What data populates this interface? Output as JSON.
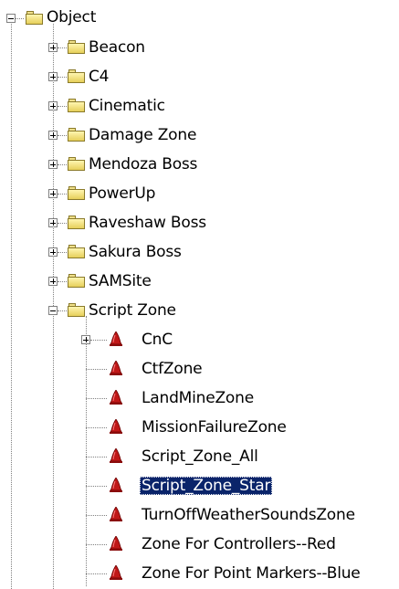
{
  "tree": {
    "root": {
      "label": "Object",
      "icon": "folder-icon",
      "expanded": true
    },
    "folders": [
      {
        "label": "Beacon",
        "icon": "folder-icon",
        "expanded": false
      },
      {
        "label": "C4",
        "icon": "folder-icon",
        "expanded": false
      },
      {
        "label": "Cinematic",
        "icon": "folder-icon",
        "expanded": false
      },
      {
        "label": "Damage Zone",
        "icon": "folder-icon",
        "expanded": false
      },
      {
        "label": "Mendoza Boss",
        "icon": "folder-icon",
        "expanded": false
      },
      {
        "label": "PowerUp",
        "icon": "folder-icon",
        "expanded": false
      },
      {
        "label": "Raveshaw Boss",
        "icon": "folder-icon",
        "expanded": false
      },
      {
        "label": "Sakura Boss",
        "icon": "folder-icon",
        "expanded": false
      },
      {
        "label": "SAMSite",
        "icon": "folder-icon",
        "expanded": false
      },
      {
        "label": "Script Zone",
        "icon": "folder-icon",
        "expanded": true
      }
    ],
    "script_zone_children": [
      {
        "label": "CnC",
        "icon": "red-cone-icon",
        "has_children": true
      },
      {
        "label": "CtfZone",
        "icon": "red-cone-icon",
        "has_children": false
      },
      {
        "label": "LandMineZone",
        "icon": "red-cone-icon",
        "has_children": false
      },
      {
        "label": "MissionFailureZone",
        "icon": "red-cone-icon",
        "has_children": false
      },
      {
        "label": "Script_Zone_All",
        "icon": "red-cone-icon",
        "has_children": false
      },
      {
        "label": "Script_Zone_Star",
        "icon": "red-cone-icon",
        "has_children": false,
        "selected": true
      },
      {
        "label": "TurnOffWeatherSoundsZone",
        "icon": "red-cone-icon",
        "has_children": false
      },
      {
        "label": "Zone For Controllers--Red",
        "icon": "red-cone-icon",
        "has_children": false
      },
      {
        "label": "Zone For Point Markers--Blue",
        "icon": "red-cone-icon",
        "has_children": false
      }
    ],
    "colors": {
      "selection_background": "#0a246a",
      "selection_text": "#ffffff",
      "tree_lines": "#808080",
      "folder_fill": "#f5e27a",
      "cone_fill": "#c01818"
    }
  }
}
